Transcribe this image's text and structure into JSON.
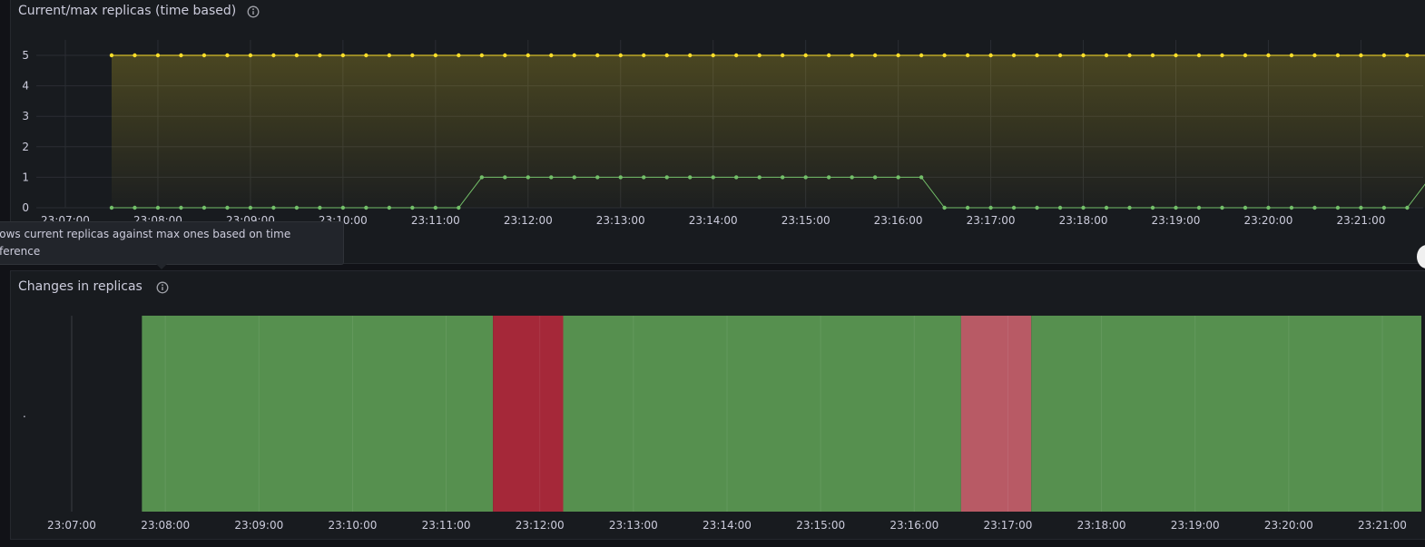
{
  "panels": {
    "replicas": {
      "title": "Current/max replicas (time based)",
      "info_icon": "info-circle-icon",
      "tooltip_line1": "Shows current replicas against max ones based on time",
      "tooltip_line2": "difference"
    },
    "changes": {
      "title": "Changes in replicas",
      "info_icon": "info-circle-icon",
      "y_tick": "."
    }
  },
  "colors": {
    "max_series": "#fade2a",
    "current_series": "#73bf69",
    "state_ok": "#56904f",
    "state_changed": "#a52839",
    "state_changed_light": "#b85a65",
    "grid": "#2a2d33",
    "tick_text": "#ccccdc"
  },
  "chart_data": [
    {
      "type": "line",
      "title": "Current/max replicas (time based)",
      "ylim": [
        0,
        5
      ],
      "y_ticks": [
        "0",
        "1",
        "2",
        "3",
        "4",
        "5"
      ],
      "x_ticks": [
        "23:07:00",
        "23:08:00",
        "23:09:00",
        "23:10:00",
        "23:11:00",
        "23:12:00",
        "23:13:00",
        "23:14:00",
        "23:15:00",
        "23:16:00",
        "23:17:00",
        "23:18:00",
        "23:19:00",
        "23:20:00",
        "23:21:00"
      ],
      "x_start_time": "23:07:00",
      "x_end_time": "23:21:30",
      "sample_first_time": "23:07:30",
      "sample_interval_seconds": 15,
      "series": [
        {
          "color": "#fade2a",
          "fill": true,
          "values": [
            5,
            5,
            5,
            5,
            5,
            5,
            5,
            5,
            5,
            5,
            5,
            5,
            5,
            5,
            5,
            5,
            5,
            5,
            5,
            5,
            5,
            5,
            5,
            5,
            5,
            5,
            5,
            5,
            5,
            5,
            5,
            5,
            5,
            5,
            5,
            5,
            5,
            5,
            5,
            5,
            5,
            5,
            5,
            5,
            5,
            5,
            5,
            5,
            5,
            5,
            5,
            5,
            5,
            5,
            5,
            5,
            5,
            5
          ]
        },
        {
          "color": "#73bf69",
          "fill": false,
          "values": [
            0,
            0,
            0,
            0,
            0,
            0,
            0,
            0,
            0,
            0,
            0,
            0,
            0,
            0,
            0,
            0,
            1,
            1,
            1,
            1,
            1,
            1,
            1,
            1,
            1,
            1,
            1,
            1,
            1,
            1,
            1,
            1,
            1,
            1,
            1,
            1,
            0,
            0,
            0,
            0,
            0,
            0,
            0,
            0,
            0,
            0,
            0,
            0,
            0,
            0,
            0,
            0,
            0,
            0,
            0,
            0,
            0,
            1
          ]
        }
      ]
    },
    {
      "type": "state_timeline",
      "title": "Changes in replicas",
      "x_ticks": [
        "23:07:00",
        "23:08:00",
        "23:09:00",
        "23:10:00",
        "23:11:00",
        "23:12:00",
        "23:13:00",
        "23:14:00",
        "23:15:00",
        "23:16:00",
        "23:17:00",
        "23:18:00",
        "23:19:00",
        "23:20:00",
        "23:21:00"
      ],
      "segments": [
        {
          "start": "23:07:45",
          "end": "23:11:30",
          "color": "#56904f"
        },
        {
          "start": "23:11:30",
          "end": "23:12:15",
          "color": "#a52839"
        },
        {
          "start": "23:12:15",
          "end": "23:16:30",
          "color": "#56904f"
        },
        {
          "start": "23:16:30",
          "end": "23:17:15",
          "color": "#b85a65"
        },
        {
          "start": "23:17:15",
          "end": "23:21:30",
          "color": "#56904f"
        },
        {
          "start": "23:21:30",
          "end": "23:21:36",
          "color": "#a52839"
        }
      ]
    }
  ]
}
